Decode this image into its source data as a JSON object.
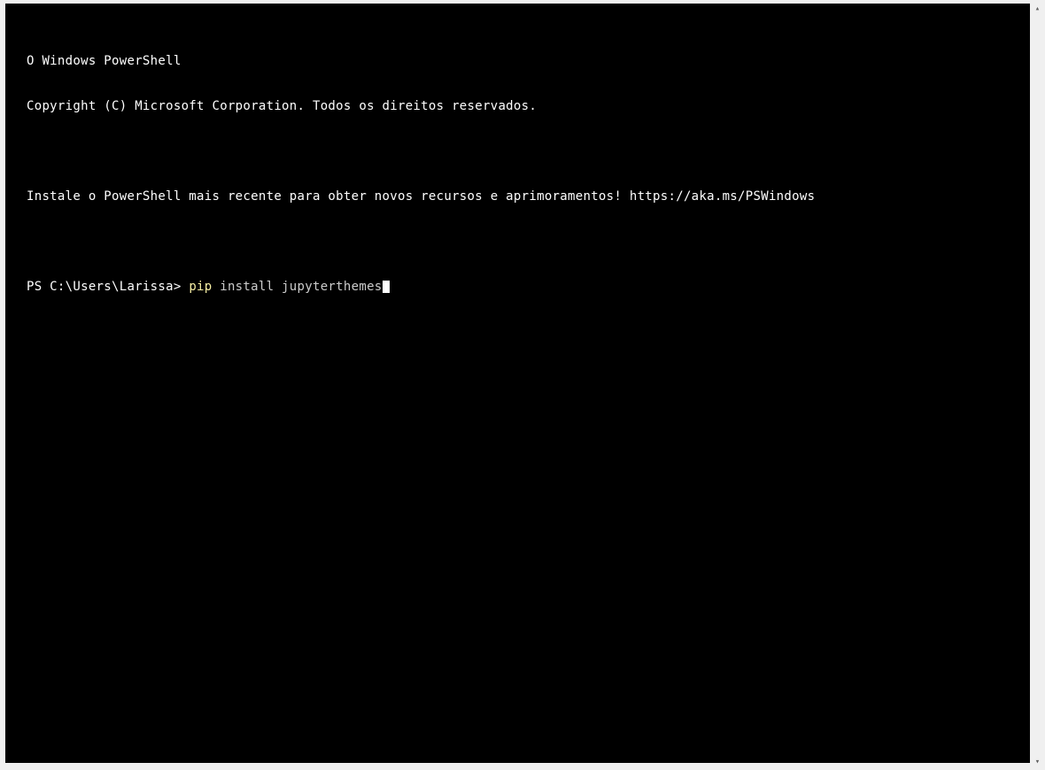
{
  "terminal": {
    "banner_line1": "O Windows PowerShell",
    "banner_line2": "Copyright (C) Microsoft Corporation. Todos os direitos reservados.",
    "notice": "Instale o PowerShell mais recente para obter novos recursos e aprimoramentos! https://aka.ms/PSWindows",
    "prompt": "PS C:\\Users\\Larissa> ",
    "command_token": "pip",
    "command_args": " install jupyterthemes"
  },
  "scrollbar": {
    "up_glyph": "▴",
    "down_glyph": "▾"
  },
  "colors": {
    "background": "#000000",
    "foreground": "#ffffff",
    "command_highlight": "#f9f1a5",
    "args_color": "#cccccc"
  }
}
